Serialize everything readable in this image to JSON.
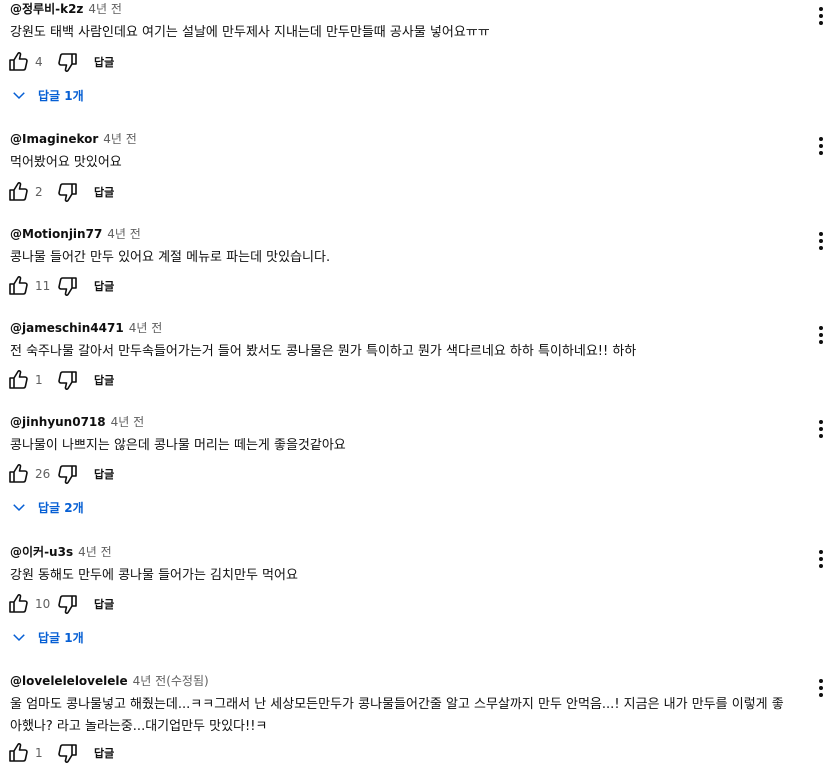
{
  "ui": {
    "reply_label": "답글",
    "edited_label": "(수정됨)"
  },
  "comments": [
    {
      "author": "@정루비-k2z",
      "time": "4년 전",
      "text": "강원도 태백 사람인데요 여기는 설날에 만두제사 지내는데 만두만들때 공사물 넣어요ㅠㅠ",
      "likes": "4",
      "replies_label": "답글 1개"
    },
    {
      "author": "@Imaginekor",
      "time": "4년 전",
      "text": "먹어봤어요 맛있어요",
      "likes": "2"
    },
    {
      "author": "@Motionjin77",
      "time": "4년 전",
      "text": "콩나물 들어간 만두 있어요 계절 메뉴로 파는데 맛있습니다.",
      "likes": "11"
    },
    {
      "author": "@jameschin4471",
      "time": "4년 전",
      "text": "전 숙주나물 갈아서 만두속들어가는거 들어 봤서도 콩나물은 뭔가 특이하고 뭔가 색다르네요 하하 특이하네요!!  하하",
      "likes": "1"
    },
    {
      "author": "@jinhyun0718",
      "time": "4년 전",
      "text": "콩나물이 나쁘지는 않은데 콩나물 머리는 떼는게 좋을것같아요",
      "likes": "26",
      "replies_label": "답글 2개"
    },
    {
      "author": "@이커-u3s",
      "time": "4년 전",
      "text": "강원 동해도 만두에 콩나물 들어가는 김치만두 먹어요",
      "likes": "10",
      "replies_label": "답글 1개"
    },
    {
      "author": "@lovelelelovelele",
      "time": "4년 전",
      "text": "울 엄마도 콩나물넣고 해줬는데...ㅋㅋ그래서 난 세상모든만두가 콩나물들어간줄 알고 스무살까지 만두 안먹음...! 지금은 내가 만두를 이렇게 좋아했나? 라고 놀라는중...대기업만두 맛있다!!ㅋ",
      "likes": "1",
      "edited": true
    }
  ]
}
